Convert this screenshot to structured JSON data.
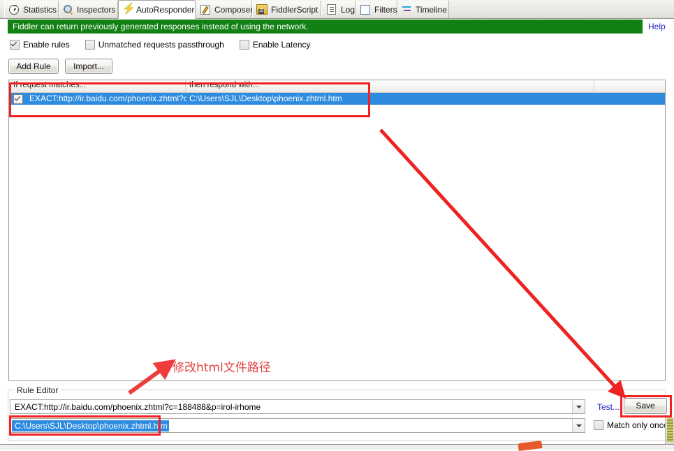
{
  "window": {
    "app": "Fiddler",
    "active_tab": "AutoResponder"
  },
  "tabs": [
    {
      "label": "Statistics",
      "icon": "stopwatch-icon",
      "active": false
    },
    {
      "label": "Inspectors",
      "icon": "magnifier-icon",
      "active": false
    },
    {
      "label": "AutoResponder",
      "icon": "lightning-bolt-icon",
      "active": true
    },
    {
      "label": "Composer",
      "icon": "compose-pencil-icon",
      "active": false
    },
    {
      "label": "FiddlerScript",
      "icon": "script-js-icon",
      "active": false
    },
    {
      "label": "Log",
      "icon": "document-icon",
      "active": false
    },
    {
      "label": "Filters",
      "icon": "filter-box-icon",
      "active": false
    },
    {
      "label": "Timeline",
      "icon": "timeline-bars-icon",
      "active": false
    }
  ],
  "banner": {
    "message": "Fiddler can return previously generated responses instead of using the network.",
    "help_label": "Help",
    "background_color": "#128012",
    "text_color": "#ffffff",
    "help_color": "#2222cc"
  },
  "options": [
    {
      "label": "Enable rules",
      "checked": true
    },
    {
      "label": "Unmatched requests passthrough",
      "checked": false
    },
    {
      "label": "Enable Latency",
      "checked": false
    }
  ],
  "toolbar": {
    "add_rule_label": "Add Rule",
    "import_label": "Import..."
  },
  "rule_list": {
    "columns": [
      "If request matches...",
      "then respond with..."
    ],
    "rows": [
      {
        "enabled": true,
        "match": "EXACT:http://ir.baidu.com/phoenix.zhtml?c...",
        "respond": "C:\\Users\\SJL\\Desktop\\phoenix.zhtml.htm",
        "selected": true
      }
    ],
    "selection_color": "#2d8ce0"
  },
  "rule_editor": {
    "legend": "Rule Editor",
    "match_value": "EXACT:http://ir.baidu.com/phoenix.zhtml?c=188488&p=irol-irhome",
    "respond_value": "C:\\Users\\SJL\\Desktop\\phoenix.zhtml.htm",
    "respond_value_selected": true,
    "test_label": "Test...",
    "save_label": "Save",
    "match_only_once": {
      "label": "Match only once",
      "checked": false
    }
  },
  "annotations": {
    "note_text": "修改html文件路径",
    "note_color": "#e24444",
    "highlight_color": "#ee2222",
    "arrow_color": "#ee2222",
    "targets": [
      "rule-list-row",
      "respond-path-combo",
      "save-button"
    ]
  }
}
